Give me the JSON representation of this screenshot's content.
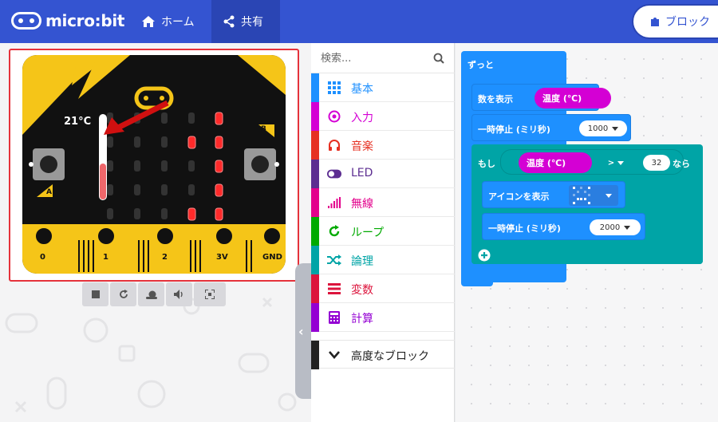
{
  "topbar": {
    "logo_text": "micro:bit",
    "home_label": "ホーム",
    "share_label": "共有",
    "blocks_label": "ブロック"
  },
  "simulator": {
    "temperature": "21°C",
    "button_a": "A",
    "button_b": "B",
    "pins": [
      "0",
      "1",
      "2",
      "3V",
      "GND"
    ],
    "temperature_fill_fraction": 0.42
  },
  "toolbox": {
    "search_placeholder": "検索...",
    "categories": [
      {
        "label": "基本",
        "color": "#1e90ff",
        "icon": "grid-icon"
      },
      {
        "label": "入力",
        "color": "#d400d4",
        "icon": "target-icon"
      },
      {
        "label": "音楽",
        "color": "#e63022",
        "icon": "headphones-icon"
      },
      {
        "label": "LED",
        "color": "#5c2d91",
        "icon": "toggle-icon"
      },
      {
        "label": "無線",
        "color": "#e3008c",
        "icon": "signal-icon"
      },
      {
        "label": "ループ",
        "color": "#00aa00",
        "icon": "loop-icon"
      },
      {
        "label": "論理",
        "color": "#00a4a6",
        "icon": "shuffle-icon"
      },
      {
        "label": "変数",
        "color": "#dc143c",
        "icon": "list-icon"
      },
      {
        "label": "計算",
        "color": "#9400d3",
        "icon": "calculator-icon"
      }
    ],
    "advanced_label": "高度なブロック"
  },
  "workspace": {
    "forever_label": "ずっと",
    "show_number_label": "数を表示",
    "temperature_label": "温度 (℃)",
    "pause_label": "一時停止 (ミリ秒)",
    "pause_value_1": "1000",
    "if_label": "もし",
    "comparison_label": "温度 (℃)",
    "operator": ">",
    "threshold": "32",
    "then_label": "なら",
    "show_icon_label": "アイコンを表示",
    "pause_value_2": "2000"
  },
  "colors": {
    "topbar": "#3454d1",
    "basic_block": "#1e90ff",
    "input_block": "#d400d4",
    "logic_block": "#00a4a6",
    "led_red": "#ff2a2a",
    "board_yellow": "#f5c518"
  }
}
